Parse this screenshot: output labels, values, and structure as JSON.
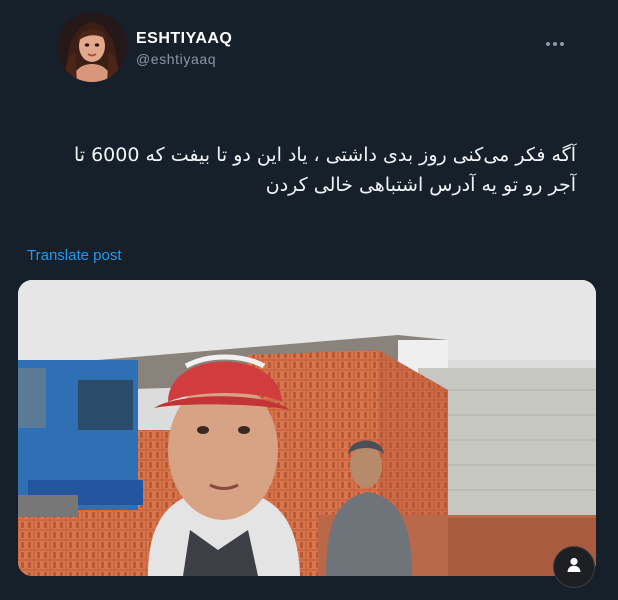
{
  "author": {
    "display_name": "ESHTIYAAQ",
    "handle": "@eshtiyaaq"
  },
  "tweet": {
    "lines": [
      "آگه فکر می‌کنی روز بدی داشتی ، یاد این دو تا بیفت که 6000 تا",
      "آجر رو تو یه آدرس اشتباهی خالی کردن"
    ]
  },
  "actions": {
    "translate_label": "Translate post"
  },
  "icons": {
    "more": "more-horizontal-icon",
    "account": "person-icon"
  },
  "colors": {
    "background": "#15202b",
    "link": "#1d9bf0",
    "secondary_text": "#8b98a5"
  }
}
